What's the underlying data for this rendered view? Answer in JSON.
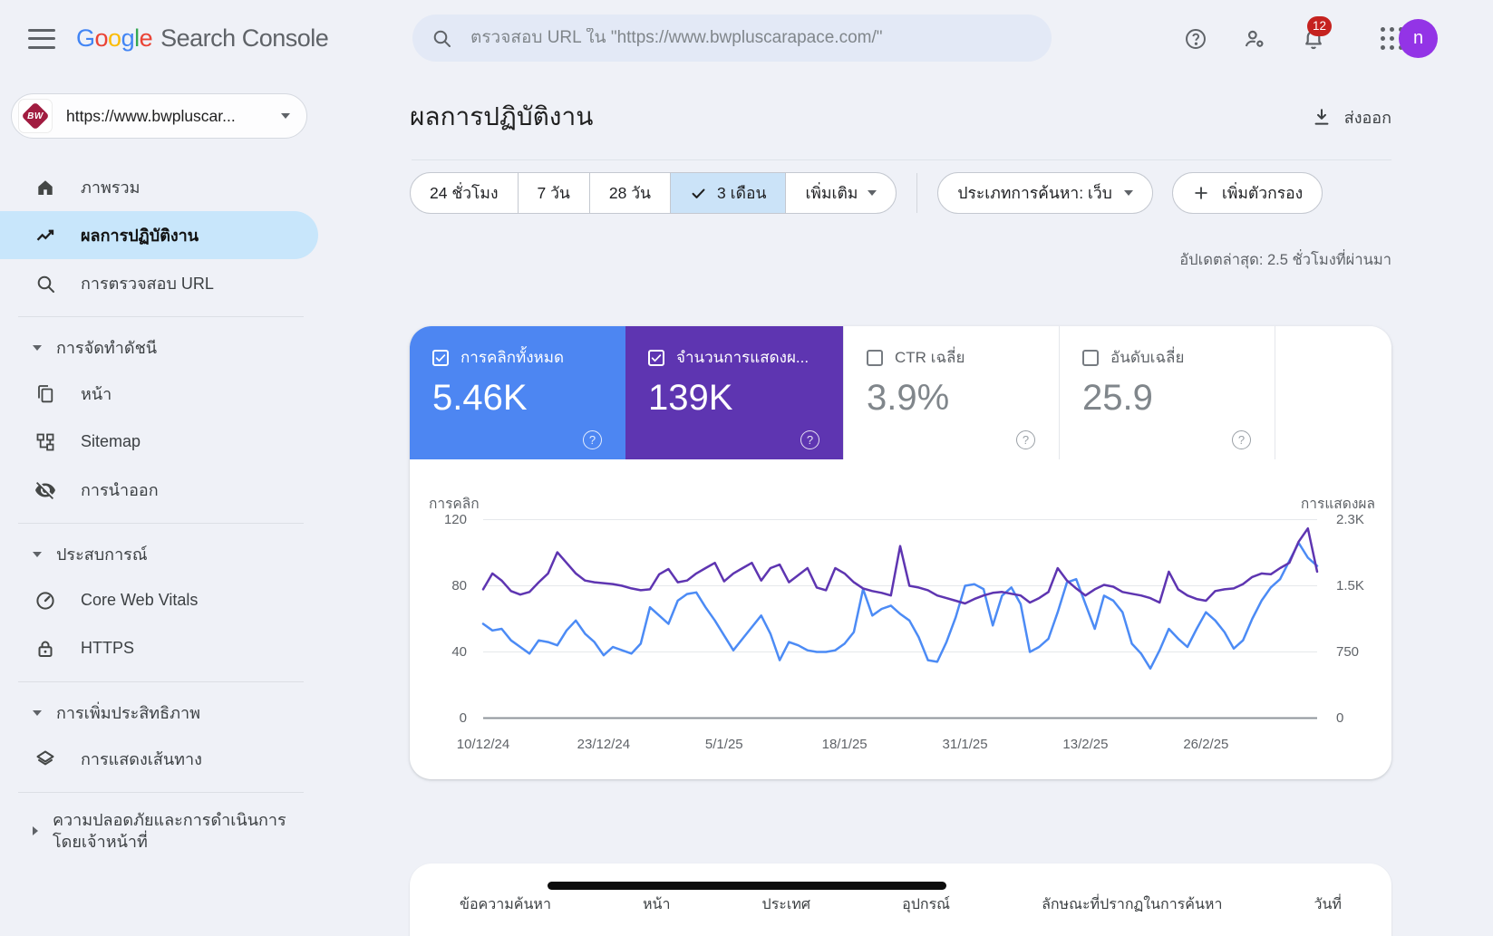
{
  "header": {
    "logo": {
      "letters": [
        "G",
        "o",
        "o",
        "g",
        "l",
        "e"
      ],
      "rest": "Search Console"
    },
    "search_placeholder": "ตรวจสอบ URL ใน \"https://www.bwpluscarapace.com/\"",
    "notification_count": "12",
    "avatar_letter": "n"
  },
  "sidebar": {
    "property": {
      "label": "https://www.bwpluscar...",
      "logo_text": "BW"
    },
    "items": [
      {
        "label": "ภาพรวม"
      },
      {
        "label": "ผลการปฏิบัติงาน"
      },
      {
        "label": "การตรวจสอบ URL"
      },
      {
        "label": "การจัดทำดัชนี"
      },
      {
        "label": "หน้า"
      },
      {
        "label": "Sitemap"
      },
      {
        "label": "การนำออก"
      },
      {
        "label": "ประสบการณ์"
      },
      {
        "label": "Core Web Vitals"
      },
      {
        "label": "HTTPS"
      },
      {
        "label": "การเพิ่มประสิทธิภาพ"
      },
      {
        "label": "การแสดงเส้นทาง"
      },
      {
        "label": "ความปลอดภัยและการดำเนินการโดยเจ้าหน้าที่"
      }
    ]
  },
  "main": {
    "title": "ผลการปฏิบัติงาน",
    "export_label": "ส่งออก",
    "date_ranges": [
      "24 ชั่วโมง",
      "7 วัน",
      "28 วัน",
      "3 เดือน",
      "เพิ่มเติม"
    ],
    "active_range": "3 เดือน",
    "search_type_filter": "ประเภทการค้นหา: เว็บ",
    "add_filter_label": "เพิ่มตัวกรอง",
    "last_updated": "อัปเดตล่าสุด: 2.5 ชั่วโมงที่ผ่านมา",
    "metrics": [
      {
        "label": "การคลิกทั้งหมด",
        "value": "5.46K",
        "checked": true,
        "color": "#4d86f2"
      },
      {
        "label": "จำนวนการแสดงผ...",
        "value": "139K",
        "checked": true,
        "color": "#5e35b1"
      },
      {
        "label": "CTR เฉลี่ย",
        "value": "3.9%",
        "checked": false,
        "color": "#ffffff"
      },
      {
        "label": "อันดับเฉลี่ย",
        "value": "25.9",
        "checked": false,
        "color": "#ffffff"
      }
    ],
    "table_tabs": [
      "ข้อความค้นหา",
      "หน้า",
      "ประเทศ",
      "อุปกรณ์",
      "ลักษณะที่ปรากฏในการค้นหา",
      "วันที่"
    ]
  },
  "chart_data": {
    "type": "line",
    "title": "ผลการปฏิบัติงาน - การคลิกและการแสดงผล",
    "grid": true,
    "legend_position": "none",
    "left_axis": {
      "label": "การคลิก",
      "max": 120,
      "ticks": [
        0,
        40,
        80,
        120
      ],
      "tick_labels": [
        "0",
        "40",
        "80",
        "120"
      ]
    },
    "right_axis": {
      "label": "การแสดงผล",
      "max": 2250,
      "ticks": [
        0,
        750,
        1500,
        2250
      ],
      "tick_labels": [
        "0",
        "750",
        "1.5K",
        "2.3K"
      ]
    },
    "x_ticks": [
      "10/12/24",
      "23/12/24",
      "5/1/25",
      "18/1/25",
      "31/1/25",
      "13/2/25",
      "26/2/25"
    ],
    "x_tick_fractions": [
      0,
      0.1444,
      0.2889,
      0.4333,
      0.5778,
      0.7222,
      0.8667
    ],
    "x_range": {
      "start": "10/12/24",
      "end": "10/3/25",
      "points": 91
    },
    "series": [
      {
        "name": "การคลิก",
        "axis": "left",
        "color": "#4c8bf5",
        "values": [
          57,
          53,
          54,
          47,
          43,
          39,
          47,
          46,
          44,
          53,
          59,
          51,
          46,
          38,
          43,
          41,
          39,
          45,
          67,
          62,
          57,
          71,
          75,
          76,
          67,
          59,
          50,
          41,
          48,
          55,
          62,
          51,
          35,
          46,
          44,
          41,
          40,
          40,
          41,
          45,
          52,
          78,
          62,
          66,
          68,
          63,
          59,
          49,
          35,
          34,
          46,
          61,
          80,
          81,
          78,
          56,
          74,
          79,
          69,
          40,
          43,
          48,
          64,
          82,
          84,
          69,
          54,
          74,
          71,
          64,
          45,
          39,
          30,
          41,
          54,
          48,
          43,
          54,
          64,
          59,
          52,
          42,
          47,
          60,
          71,
          79,
          84,
          95,
          106,
          97,
          92
        ]
      },
      {
        "name": "การแสดงผล",
        "axis": "right",
        "color": "#5e35b1",
        "values": [
          1460,
          1640,
          1560,
          1440,
          1400,
          1430,
          1540,
          1640,
          1880,
          1760,
          1640,
          1560,
          1540,
          1530,
          1520,
          1500,
          1470,
          1450,
          1460,
          1630,
          1690,
          1540,
          1560,
          1640,
          1700,
          1760,
          1550,
          1640,
          1700,
          1760,
          1560,
          1700,
          1740,
          1540,
          1620,
          1700,
          1480,
          1450,
          1700,
          1640,
          1540,
          1470,
          1440,
          1420,
          1390,
          1950,
          1500,
          1480,
          1450,
          1390,
          1360,
          1330,
          1300,
          1350,
          1390,
          1420,
          1430,
          1410,
          1390,
          1310,
          1360,
          1430,
          1700,
          1560,
          1470,
          1390,
          1460,
          1510,
          1490,
          1430,
          1410,
          1390,
          1360,
          1310,
          1660,
          1460,
          1390,
          1350,
          1330,
          1440,
          1460,
          1470,
          1520,
          1600,
          1640,
          1630,
          1700,
          1760,
          2000,
          2150,
          1660
        ]
      }
    ]
  }
}
